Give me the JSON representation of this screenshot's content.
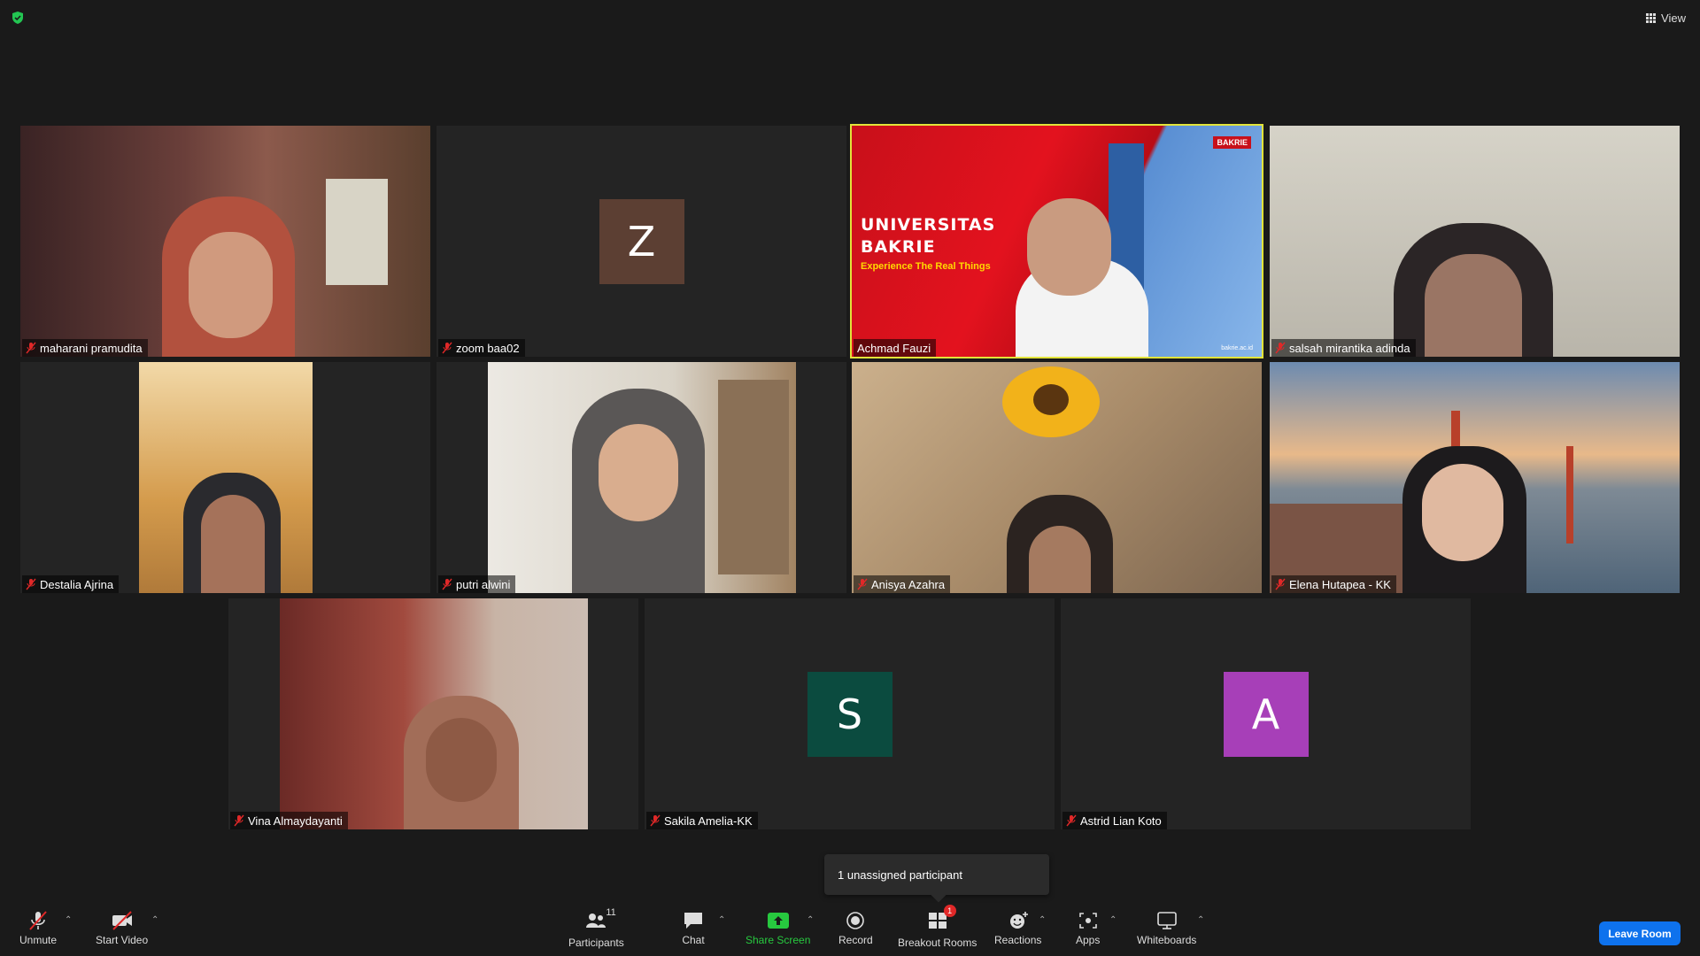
{
  "header": {
    "view_label": "View"
  },
  "tiles": [
    {
      "name": "maharani pramudita",
      "avatar": "",
      "avatar_color": ""
    },
    {
      "name": "zoom baa02",
      "avatar": "Z",
      "avatar_color": "#5c3f33"
    },
    {
      "name": "Achmad Fauzi",
      "avatar": "",
      "avatar_color": ""
    },
    {
      "name": "salsah mirantika adinda",
      "avatar": "",
      "avatar_color": ""
    },
    {
      "name": "Destalia Ajrina",
      "avatar": "",
      "avatar_color": ""
    },
    {
      "name": "putri alwini",
      "avatar": "",
      "avatar_color": ""
    },
    {
      "name": "Anisya Azahra",
      "avatar": "",
      "avatar_color": ""
    },
    {
      "name": "Elena Hutapea - KK",
      "avatar": "",
      "avatar_color": ""
    },
    {
      "name": "Vina Almaydayanti",
      "avatar": "",
      "avatar_color": ""
    },
    {
      "name": "Sakila Amelia-KK",
      "avatar": "S",
      "avatar_color": "#0b4b3f"
    },
    {
      "name": "Astrid Lian Koto",
      "avatar": "A",
      "avatar_color": "#a73fb8"
    }
  ],
  "slide": {
    "title_line1": "UNIVERSITAS",
    "title_line2": "BAKRIE",
    "tagline": "Experience The Real Things",
    "logo_text": "BAKRIE",
    "url": "bakrie.ac.id"
  },
  "popup": {
    "text": "1 unassigned participant"
  },
  "toolbar": {
    "unmute": "Unmute",
    "start_video": "Start Video",
    "participants": "Participants",
    "participants_count": "11",
    "chat": "Chat",
    "share_screen": "Share Screen",
    "record": "Record",
    "breakout_rooms": "Breakout Rooms",
    "breakout_badge": "1",
    "reactions": "Reactions",
    "apps": "Apps",
    "whiteboards": "Whiteboards",
    "leave_room": "Leave Room"
  },
  "colors": {
    "active_speaker": "#e2e43a",
    "share_green": "#27c93f",
    "leave_blue": "#0e72ed",
    "mute_red": "#e02828"
  }
}
